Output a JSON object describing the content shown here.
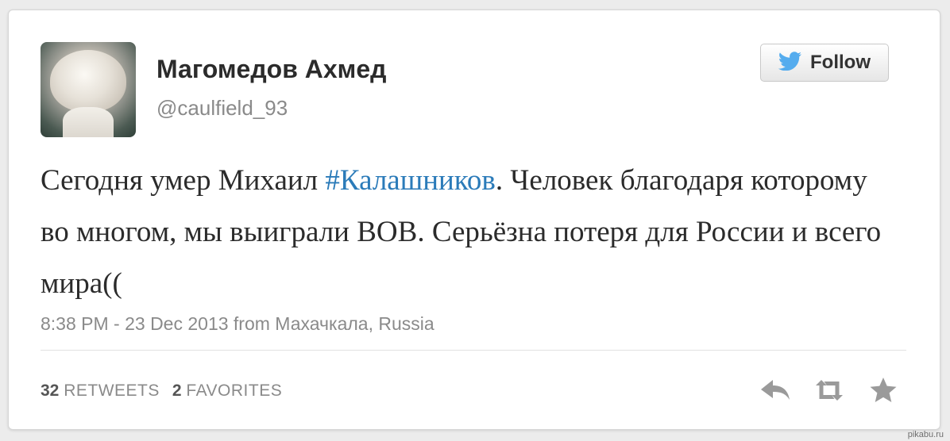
{
  "user": {
    "name": "Магомедов Ахмед",
    "handle": "@caulfield_93"
  },
  "follow_button": {
    "label": "Follow",
    "icon": "bird-icon"
  },
  "tweet": {
    "before_hashtag": "Сегодня умер Михаил ",
    "hashtag": "#Калашников",
    "after_hashtag": ". Человек благодаря которому во многом, мы выиграли ВОВ. Серьёзна потеря для России и всего мира((",
    "timestamp": "8:38 PM - 23 Dec 2013 from Махачкала, Russia"
  },
  "stats": {
    "retweets_count": "32",
    "retweets_label": "RETWEETS",
    "favorites_count": "2",
    "favorites_label": "FAVORITES"
  },
  "actions": [
    {
      "name": "reply-icon"
    },
    {
      "name": "retweet-icon"
    },
    {
      "name": "favorite-star-icon"
    }
  ],
  "colors": {
    "hashtag": "#2b7bb9",
    "twitter_bird": "#55acee",
    "action_icon": "#9a9a9a"
  },
  "watermark": "pikabu.ru"
}
